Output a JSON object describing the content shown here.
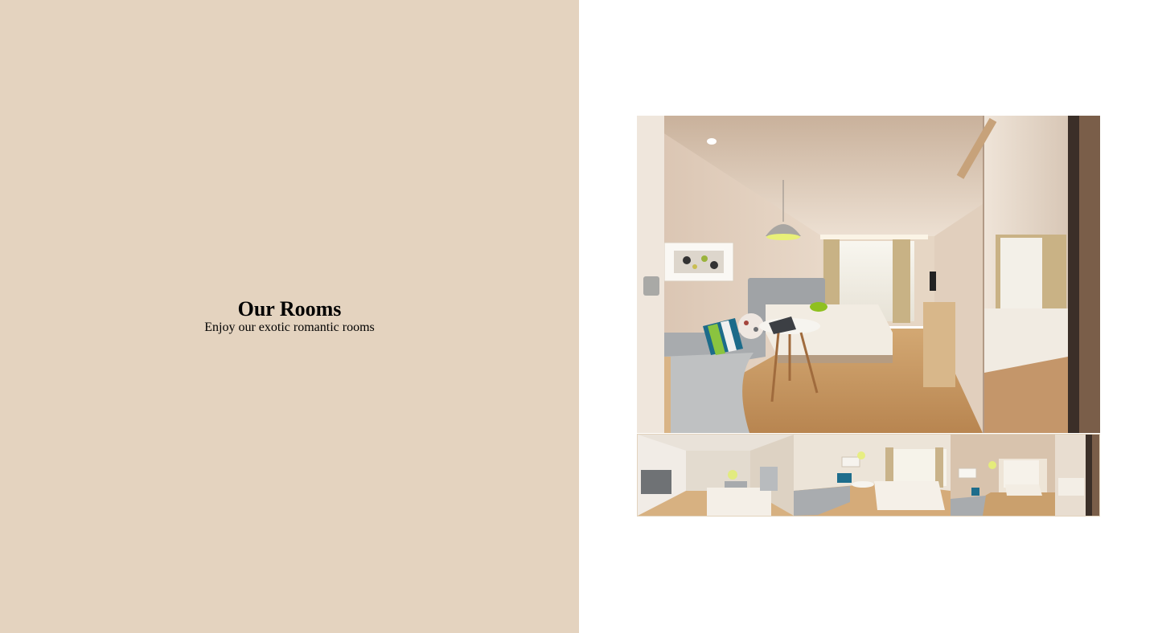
{
  "intro": {
    "title": "Our Rooms",
    "subtitle": "Enjoy our exotic romantic rooms"
  },
  "colors": {
    "left_panel_bg": "#e4d3bf",
    "right_panel_bg": "#ffffff"
  },
  "gallery": {
    "main_image": "hotel-room-photo",
    "thumbnails": [
      "hotel-room-thumb-1",
      "hotel-room-thumb-2",
      "hotel-room-thumb-3"
    ]
  }
}
